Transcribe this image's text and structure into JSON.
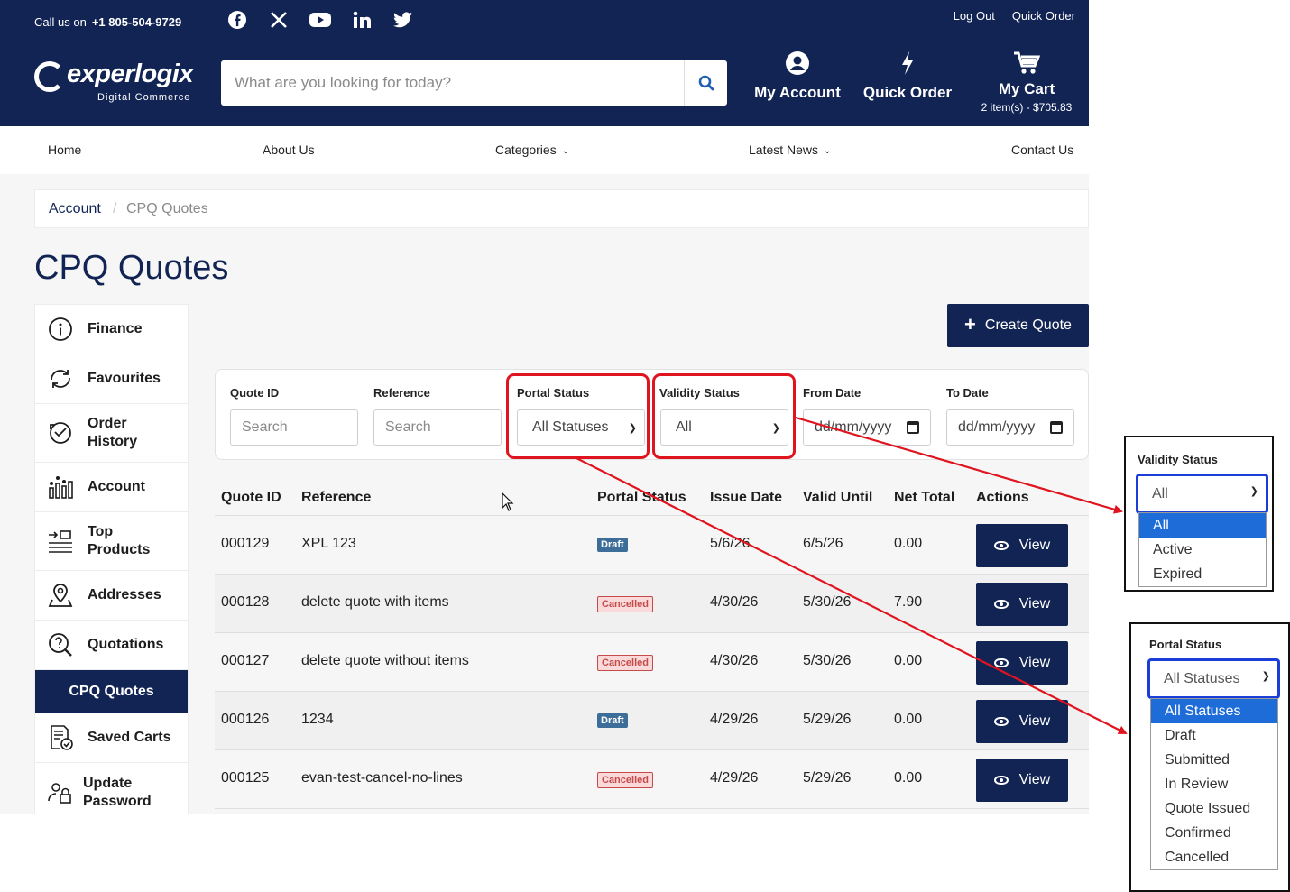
{
  "topbar": {
    "call_prefix": "Call us on",
    "phone": "+1 805-504-9729",
    "social": [
      "facebook-icon",
      "x-icon",
      "youtube-icon",
      "linkedin-icon",
      "twitter-icon"
    ],
    "links": [
      "Log Out",
      "Quick Order"
    ]
  },
  "logo": {
    "word": "experlogix",
    "sub": "Digital Commerce"
  },
  "search": {
    "placeholder": "What are you looking for today?"
  },
  "header_actions": {
    "account": "My Account",
    "quick_order": "Quick Order",
    "cart": "My Cart",
    "cart_summary": "2 item(s) - $705.83"
  },
  "nav": {
    "home": "Home",
    "about": "About Us",
    "categories": "Categories",
    "news": "Latest News",
    "contact": "Contact Us"
  },
  "breadcrumb": {
    "parent": "Account",
    "separator": "/",
    "current": "CPQ Quotes"
  },
  "page_title": "CPQ Quotes",
  "sidebar": {
    "items": [
      {
        "label": "Finance"
      },
      {
        "label": "Favourites"
      },
      {
        "label": "Order History"
      },
      {
        "label": "Account"
      },
      {
        "label": "Top Products"
      },
      {
        "label": "Addresses"
      },
      {
        "label": "Quotations"
      },
      {
        "label": "CPQ Quotes"
      },
      {
        "label": "Saved Carts"
      },
      {
        "label": "Update Password"
      }
    ]
  },
  "create_button": "Create Quote",
  "filters": {
    "quote_id": {
      "label": "Quote ID",
      "placeholder": "Search"
    },
    "reference": {
      "label": "Reference",
      "placeholder": "Search"
    },
    "portal_status": {
      "label": "Portal Status",
      "value": "All Statuses"
    },
    "validity_status": {
      "label": "Validity Status",
      "value": "All"
    },
    "from_date": {
      "label": "From Date",
      "placeholder": "dd/mm/yyyy"
    },
    "to_date": {
      "label": "To Date",
      "placeholder": "dd/mm/yyyy"
    }
  },
  "table": {
    "headers": [
      "Quote ID",
      "Reference",
      "Portal Status",
      "Issue Date",
      "Valid Until",
      "Net Total",
      "Actions"
    ],
    "view_label": "View",
    "rows": [
      {
        "id": "000129",
        "reference": "XPL 123",
        "status": "Draft",
        "issue": "5/6/26",
        "valid": "6/5/26",
        "total": "0.00"
      },
      {
        "id": "000128",
        "reference": "delete quote with items",
        "status": "Cancelled",
        "issue": "4/30/26",
        "valid": "5/30/26",
        "total": "7.90"
      },
      {
        "id": "000127",
        "reference": "delete quote without items",
        "status": "Cancelled",
        "issue": "4/30/26",
        "valid": "5/30/26",
        "total": "0.00"
      },
      {
        "id": "000126",
        "reference": "1234",
        "status": "Draft",
        "issue": "4/29/26",
        "valid": "5/29/26",
        "total": "0.00"
      },
      {
        "id": "000125",
        "reference": "evan-test-cancel-no-lines",
        "status": "Cancelled",
        "issue": "4/29/26",
        "valid": "5/29/26",
        "total": "0.00"
      }
    ]
  },
  "callout_validity": {
    "label": "Validity Status",
    "value": "All",
    "options": [
      "All",
      "Active",
      "Expired"
    ],
    "selected": "All"
  },
  "callout_portal": {
    "label": "Portal Status",
    "value": "All Statuses",
    "options": [
      "All Statuses",
      "Draft",
      "Submitted",
      "In Review",
      "Quote Issued",
      "Confirmed",
      "Cancelled"
    ],
    "selected": "All Statuses"
  },
  "colors": {
    "brand_navy": "#122454",
    "highlight_red": "#e0141f",
    "focus_blue": "#1c3ed8",
    "option_selected": "#1e6cd8",
    "draft_badge": "#3c6e99",
    "cancelled_badge": "#c54a4a"
  }
}
